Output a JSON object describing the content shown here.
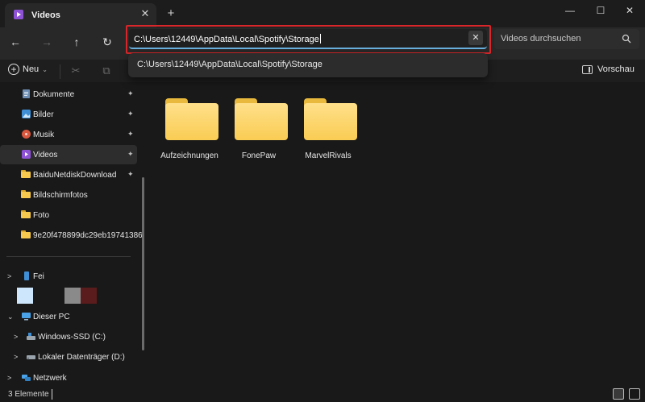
{
  "window": {
    "tab_title": "Videos",
    "tab_close_glyph": "✕",
    "new_tab_glyph": "+",
    "minimize_glyph": "—",
    "maximize_glyph": "☐",
    "close_glyph": "✕"
  },
  "nav": {
    "back_glyph": "←",
    "forward_glyph": "→",
    "up_glyph": "↑",
    "refresh_glyph": "↻",
    "address": "C:\\Users\\12449\\AppData\\Local\\Spotify\\Storage",
    "address_clear_glyph": "✕",
    "search_placeholder": "Videos durchsuchen"
  },
  "suggestion": {
    "text": "C:\\Users\\12449\\AppData\\Local\\Spotify\\Storage"
  },
  "command_bar": {
    "new_label": "Neu",
    "new_chevron": "⌄",
    "cut_glyph": "✂",
    "copy_glyph": "⧉",
    "preview_label": "Vorschau"
  },
  "sidebar": {
    "pin_glyph": "✦",
    "expand_glyph": ">",
    "collapse_glyph": "⌄",
    "quick_access": [
      {
        "label": "Dokumente",
        "icon": "documents-icon"
      },
      {
        "label": "Bilder",
        "icon": "pictures-icon"
      },
      {
        "label": "Musik",
        "icon": "music-icon"
      },
      {
        "label": "Videos",
        "icon": "videos-icon"
      },
      {
        "label": "BaiduNetdiskDownload",
        "icon": "folder-icon"
      },
      {
        "label": "Bildschirmfotos",
        "icon": "folder-icon"
      },
      {
        "label": "Foto",
        "icon": "folder-icon"
      },
      {
        "label": "9e20f478899dc29eb19741386",
        "icon": "folder-icon"
      }
    ],
    "phone_label": "Fei",
    "this_pc_label": "Dieser PC",
    "drive_c_label": "Windows-SSD (C:)",
    "drive_d_label": "Lokaler Datenträger (D:)",
    "network_label": "Netzwerk"
  },
  "folders": [
    {
      "name": "Aufzeichnungen"
    },
    {
      "name": "FonePaw"
    },
    {
      "name": "MarvelRivals"
    }
  ],
  "status": {
    "item_count": "3 Elemente"
  },
  "colors": {
    "address_highlight": "#d8262a",
    "folder_yellow": "#f9cc53",
    "accent_blue": "#6ab0de"
  }
}
